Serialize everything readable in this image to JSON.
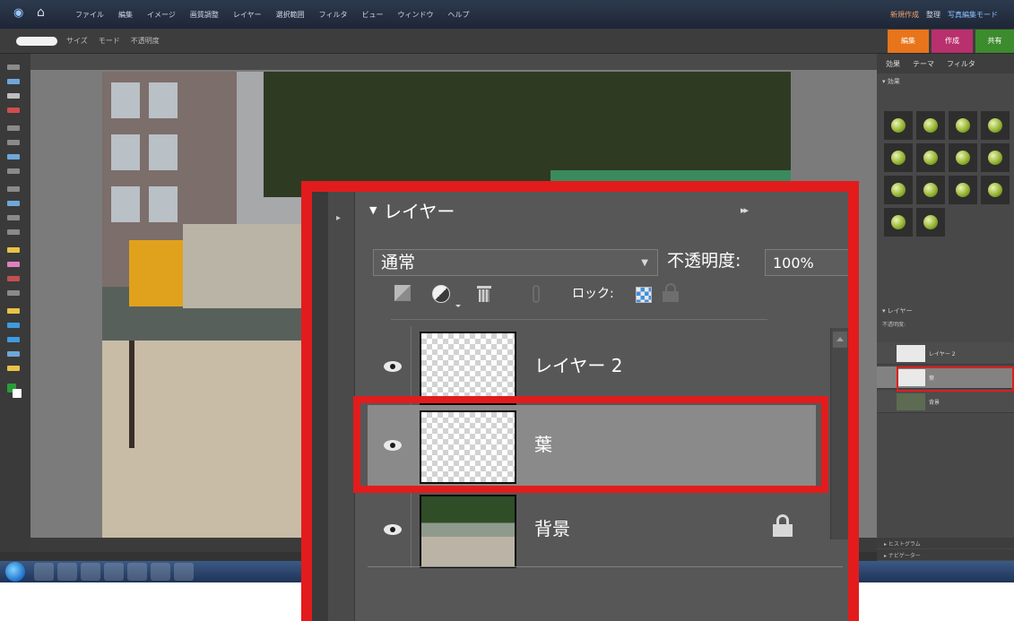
{
  "menubar": {
    "items": [
      "ファイル",
      "編集",
      "イメージ",
      "画質調整",
      "レイヤー",
      "選択範囲",
      "フィルタ",
      "ビュー",
      "ウィンドウ",
      "ヘルプ"
    ],
    "right": [
      "新規作成",
      "整理",
      "写真編集モード"
    ]
  },
  "options": {
    "items": [
      "サイズ",
      "モード",
      "不透明度"
    ]
  },
  "modes": {
    "edit": "編集",
    "create": "作成",
    "share": "共有"
  },
  "right_panel": {
    "tabs": [
      "効果",
      "テーマ",
      "フィルタ"
    ],
    "effects_title": "▾ 効果",
    "mini_layers_title": "▾ レイヤー",
    "mini_opacity": "不透明度:",
    "bottom1": "▸ ヒストグラム",
    "bottom2": "▸ ナビゲーター"
  },
  "callout": {
    "panel_title": "レイヤー",
    "panel_menu_arrows": "▸▸",
    "blend_mode": "通常",
    "opacity_label": "不透明度:",
    "opacity_value": "100%",
    "lock_label": "ロック:",
    "layers": [
      {
        "name": "レイヤー 2",
        "visible": true,
        "selected": false,
        "locked": false
      },
      {
        "name": "葉",
        "visible": true,
        "selected": true,
        "locked": false
      },
      {
        "name": "背景",
        "visible": true,
        "selected": false,
        "locked": true
      }
    ]
  },
  "colors": {
    "highlight": "#e21c1c",
    "panel_bg": "#575757",
    "selected_row": "#8a8a8a",
    "tab_edit": "#e8741b",
    "tab_create": "#b8306e",
    "tab_share": "#3c8c2e"
  }
}
